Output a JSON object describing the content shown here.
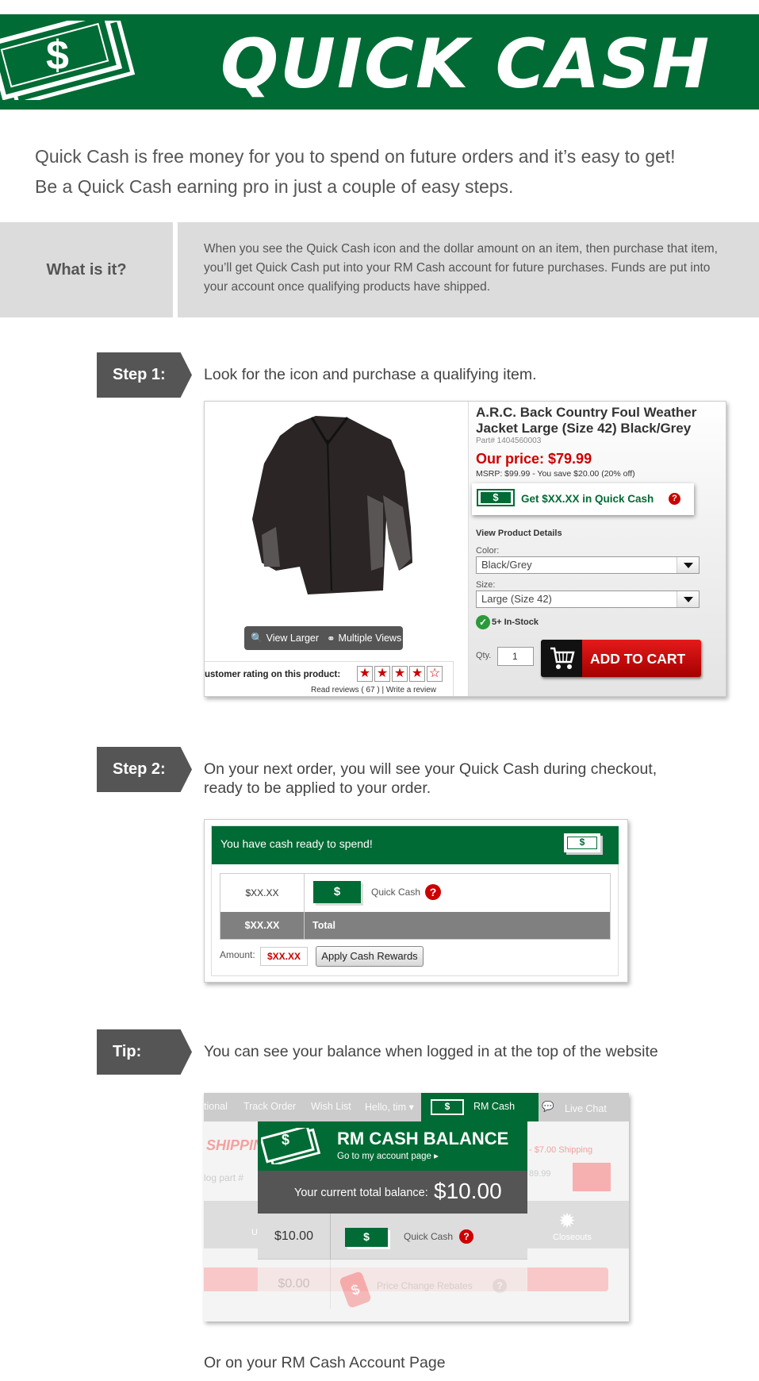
{
  "banner": {
    "title": "QUICK CASH",
    "bill_symbol": "$",
    "bg_color": "#006b34"
  },
  "intro": {
    "line1": "Quick Cash is free money for you to spend on future orders and it’s easy to get!",
    "line2": "Be a Quick Cash earning pro in just a couple of easy steps."
  },
  "what": {
    "label": "What is it?",
    "text": "When you see the Quick Cash icon and the dollar amount on an item, then purchase that item, you’ll get Quick Cash put into your RM Cash account for future purchases. Funds are put into your account once qualifying products have shipped."
  },
  "step1": {
    "tag": "Step 1:",
    "text": "Look for the icon and purchase a qualifying item.",
    "product": {
      "name": "A.R.C. Back Country Foul Weather Jacket Large (Size 42) Black/Grey",
      "part": "Part# 1404560003",
      "price": "Our price: $79.99",
      "msrp": "MSRP: $99.99 - You save $20.00 (20% off)",
      "quick_cash_symbol": "$",
      "quick_cash_text": "Get $XX.XX in Quick Cash",
      "help_symbol": "?",
      "details_label": "View Product Details",
      "color_label": "Color:",
      "color_value": "Black/Grey",
      "size_label": "Size:",
      "size_value": "Large (Size 42)",
      "stock": "5+ In-Stock",
      "stock_icon": "✓",
      "qty_label": "Qty.",
      "qty_value": "1",
      "add_to_cart": "ADD TO CART",
      "view_larger": "View Larger",
      "multiple_views": "Multiple Views",
      "rating_label": "ustomer rating on this product:",
      "rating_stars": 4.5,
      "reviews": "Read reviews ( 67 ) | Write a review"
    }
  },
  "step2": {
    "tag": "Step 2:",
    "text_line1": "On your next order, you will see your Quick Cash during checkout,",
    "text_line2": "ready to be applied to your order.",
    "checkout": {
      "header": "You have cash ready to spend!",
      "header_bill": "$",
      "row1_amount": "$XX.XX",
      "row1_bill": "$",
      "row1_label": "Quick Cash",
      "help_symbol": "?",
      "row2_amount": "$XX.XX",
      "row2_label": "Total",
      "amount_label": "Amount:",
      "amount_value": "$XX.XX",
      "apply_button": "Apply Cash Rewards"
    }
  },
  "tip": {
    "tag": "Tip:",
    "text": "You can see your balance when logged in at the top of the website",
    "balance": {
      "nav_items": [
        "tional",
        "Track Order",
        "Wish List",
        "Hello, tim ▾"
      ],
      "rm_cash_tab": "RM Cash",
      "tab_bill": "$",
      "live_chat": "Live Chat",
      "shipping_faded": "SHIPPIN",
      "part_faded": "log part #",
      "shipping_right": "- $7.00 Shipping",
      "price_right": "89.99",
      "closeouts": "Closeouts",
      "left_letter": "U",
      "title": "RM CASH BALANCE",
      "subtitle": "Go to my account page ▸",
      "head_bill": "$",
      "current_label": "Your current total balance:",
      "current_value": "$10.00",
      "row1_amount": "$10.00",
      "row1_bill": "$",
      "row1_label": "Quick Cash",
      "help_symbol": "?",
      "row2_amount": "$0.00",
      "row2_tag": "$",
      "row2_label": "Price Change Rebates"
    }
  },
  "footer_text": "Or on your RM Cash Account Page"
}
